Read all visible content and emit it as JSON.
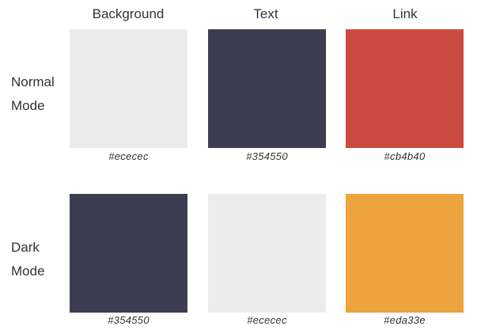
{
  "columns": {
    "background": "Background",
    "text": "Text",
    "link": "Link"
  },
  "rows": {
    "normal": {
      "label_line1": "Normal",
      "label_line2": "Mode",
      "background": "#ececec",
      "text": "#354550",
      "link": "#cb4b40"
    },
    "dark": {
      "label_line1": "Dark",
      "label_line2": "Mode",
      "background": "#354550",
      "text": "#ececec",
      "link": "#eda33e"
    }
  },
  "colors": {
    "normal_background": "#ececec",
    "normal_text": "#3c3d51",
    "normal_link": "#cb4b40",
    "dark_background": "#3c3d51",
    "dark_text": "#ececec",
    "dark_link": "#eda33e"
  }
}
